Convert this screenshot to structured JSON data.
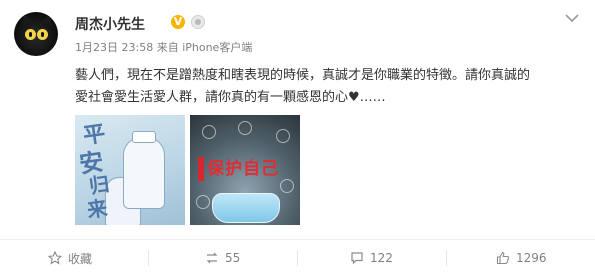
{
  "post": {
    "username": "周杰小先生",
    "verified_badge": "V",
    "timestamp": "1月23日 23:58",
    "source": "来自 iPhone客户端",
    "text_line1": "藝人們，現在不是蹭熱度和瞎表現的時候，真誠才是你職業的特徵。請你真誠的",
    "text_line2": "愛社會愛生活愛人群，請你真的有一顆感恩的心♥……",
    "images": [
      {
        "label": "picture of medical workers with calligraphy",
        "chars": [
          "平",
          "安",
          "归",
          "来"
        ]
      },
      {
        "label": "poster",
        "title": "保护自己"
      }
    ]
  },
  "actions": {
    "favorite_label": "收藏",
    "repost_count": "55",
    "comment_count": "122",
    "like_count": "1296"
  },
  "icons": {
    "star": "star-icon",
    "repost": "repost-icon",
    "comment": "comment-icon",
    "like": "thumb-up-icon",
    "menu": "chevron-down-icon"
  },
  "colors": {
    "verified": "#f7b500",
    "poster_red": "#e22b33",
    "muted_text": "#808080"
  }
}
